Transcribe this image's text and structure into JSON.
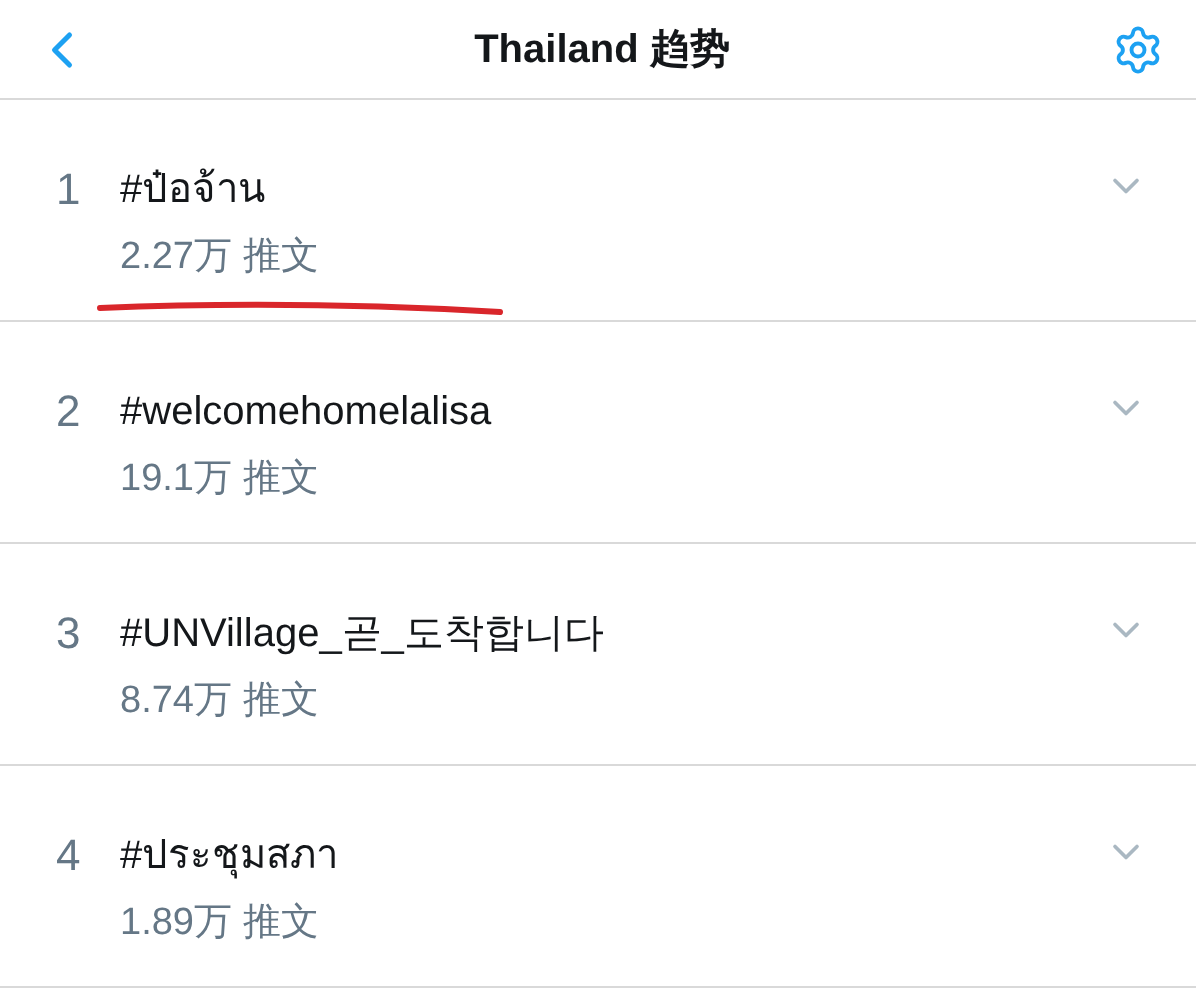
{
  "header": {
    "title": "Thailand 趋势"
  },
  "trends": [
    {
      "rank": "1",
      "tag": "#ป๋อจ้าน",
      "count": "2.27万 推文",
      "underlined": true
    },
    {
      "rank": "2",
      "tag": "#welcomehomelalisa",
      "count": "19.1万 推文",
      "underlined": false
    },
    {
      "rank": "3",
      "tag": "#UNVillage_곧_도착합니다",
      "count": "8.74万 推文",
      "underlined": false
    },
    {
      "rank": "4",
      "tag": "#ประชุมสภา",
      "count": "1.89万 推文",
      "underlined": false
    }
  ]
}
